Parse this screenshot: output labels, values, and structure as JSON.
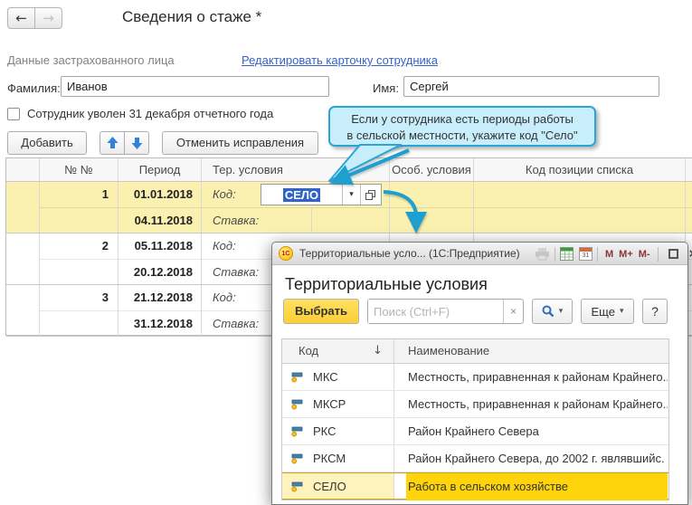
{
  "window": {
    "title": "Сведения о стаже *"
  },
  "person": {
    "section_label": "Данные застрахованного лица",
    "edit_link": "Редактировать карточку сотрудника",
    "lastname_label": "Фамилия:",
    "lastname_value": "Иванов",
    "firstname_label": "Имя:",
    "firstname_value": "Сергей",
    "fired_label": "Сотрудник уволен 31 декабря отчетного года"
  },
  "actions": {
    "add": "Добавить",
    "undo": "Отменить исправления"
  },
  "hint": {
    "line1": "Если у сотрудника есть периоды работы",
    "line2": "в сельской местности, укажите код \"Село\""
  },
  "grid": {
    "headers": {
      "num": "№ №",
      "period": "Период",
      "ter": "Тер. условия",
      "osob": "Особ. условия",
      "kod_pos": "Код позиции списка"
    },
    "rows": [
      {
        "num": "1",
        "date_from": "01.01.2018",
        "date_to": "04.11.2018",
        "kod_label": "Код:",
        "kod_value": "СЕЛО",
        "stavka_label": "Ставка:"
      },
      {
        "num": "2",
        "date_from": "05.11.2018",
        "date_to": "20.12.2018",
        "kod_label": "Код:",
        "stavka_label": "Ставка:"
      },
      {
        "num": "3",
        "date_from": "21.12.2018",
        "date_to": "31.12.2018",
        "kod_label": "Код:",
        "stavka_label": "Ставка:"
      }
    ]
  },
  "dialog": {
    "titlebar": {
      "title": "Территориальные усло... (1С:Предприятие)",
      "memory": [
        "M",
        "M+",
        "M-"
      ]
    },
    "heading": "Территориальные условия",
    "select_button": "Выбрать",
    "search_placeholder": "Поиск (Ctrl+F)",
    "more_button": "Еще",
    "help_button": "?",
    "list": {
      "col_code": "Код",
      "col_name": "Наименование",
      "items": [
        {
          "code": "МКС",
          "name": "Местность, приравненная к районам Крайнего.."
        },
        {
          "code": "МКСР",
          "name": "Местность, приравненная к районам Крайнего.."
        },
        {
          "code": "РКС",
          "name": "Район Крайнего Севера"
        },
        {
          "code": "РКСМ",
          "name": "Район Крайнего Севера, до 2002 г. являвшийс."
        },
        {
          "code": "СЕЛО",
          "name": "Работа в сельском хозяйстве"
        }
      ]
    }
  },
  "icons": {
    "back": "←",
    "forward": "→",
    "dropdown": "▾",
    "sort_desc": "↓",
    "clear": "×",
    "close": "×",
    "calendar_day": "31",
    "logo": "1С"
  },
  "colors": {
    "accent_link": "#3563c9",
    "selected_row_yellow": "#faf0b0",
    "active_cell_yellow": "#ffd40a",
    "select_button_yellow": "#ffd94a",
    "tooltip_bg": "#c9eefb",
    "tooltip_border": "#2aa5d6",
    "callout_arrow_teal": "#1e9fd0",
    "text_selection_blue": "#3164c8",
    "memory_button_red": "#8a3535"
  }
}
